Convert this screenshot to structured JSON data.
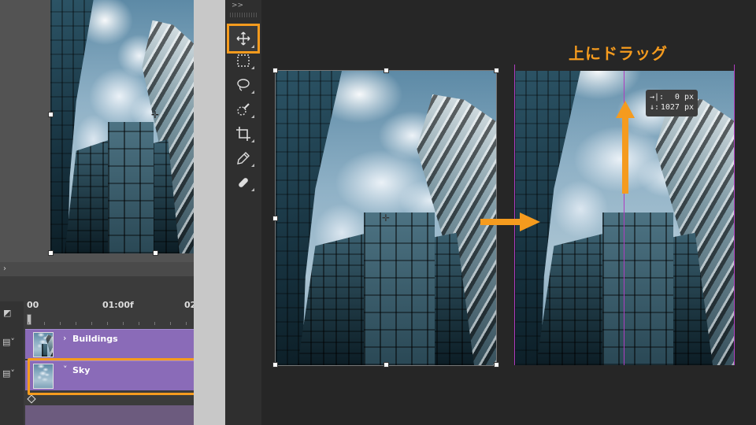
{
  "timeline": {
    "collapse_glyph": "›",
    "ruler": {
      "labels": [
        "00",
        "01:00f",
        "02"
      ]
    },
    "layers": [
      {
        "name": "Buildings",
        "expanded": false,
        "selected": false
      },
      {
        "name": "Sky",
        "expanded": true,
        "selected": true
      }
    ]
  },
  "tools": {
    "panel_grip": ">>",
    "items": [
      {
        "id": "move",
        "icon": "move-icon",
        "active": true
      },
      {
        "id": "marquee",
        "icon": "rectangle-marquee-icon",
        "active": false
      },
      {
        "id": "lasso",
        "icon": "lasso-icon",
        "active": false
      },
      {
        "id": "quick-select",
        "icon": "quick-selection-brush-icon",
        "active": false
      },
      {
        "id": "crop",
        "icon": "crop-icon",
        "active": false
      },
      {
        "id": "eyedropper",
        "icon": "eyedropper-icon",
        "active": false
      },
      {
        "id": "healing",
        "icon": "healing-brush-icon",
        "active": false
      }
    ]
  },
  "instruction": {
    "caption": "上にドラッグ"
  },
  "offset_tooltip": {
    "dx_label": "→|:",
    "dx_value": "0 px",
    "dy_label": "↓:",
    "dy_value": "1027 px"
  },
  "colors": {
    "accent_orange": "#f59b1e",
    "timeline_purple": "#8a6bb8",
    "guide_magenta": "#b03cc0",
    "panel_dark": "#2f2f2f"
  }
}
